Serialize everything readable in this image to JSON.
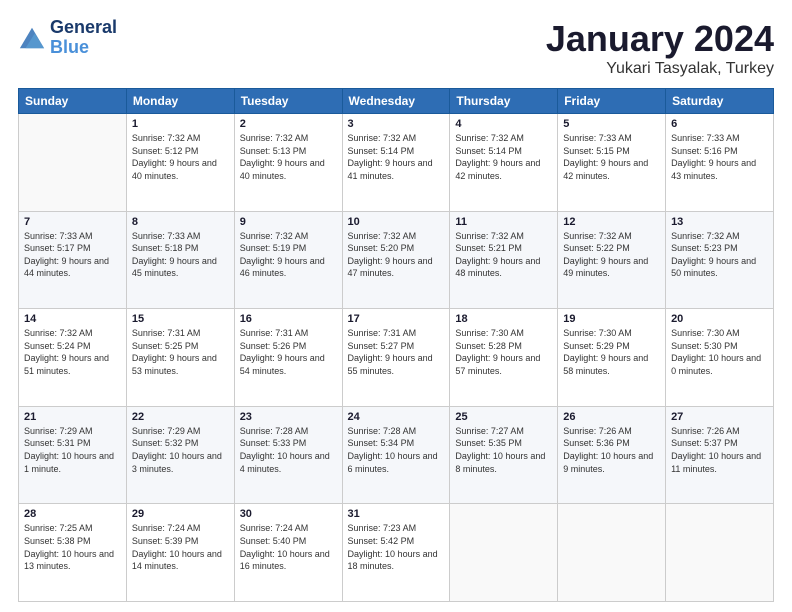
{
  "logo": {
    "line1": "General",
    "line2": "Blue"
  },
  "title": {
    "month": "January 2024",
    "location": "Yukari Tasyalak, Turkey"
  },
  "headers": [
    "Sunday",
    "Monday",
    "Tuesday",
    "Wednesday",
    "Thursday",
    "Friday",
    "Saturday"
  ],
  "weeks": [
    [
      {
        "day": "",
        "sunrise": "",
        "sunset": "",
        "daylight": ""
      },
      {
        "day": "1",
        "sunrise": "Sunrise: 7:32 AM",
        "sunset": "Sunset: 5:12 PM",
        "daylight": "Daylight: 9 hours and 40 minutes."
      },
      {
        "day": "2",
        "sunrise": "Sunrise: 7:32 AM",
        "sunset": "Sunset: 5:13 PM",
        "daylight": "Daylight: 9 hours and 40 minutes."
      },
      {
        "day": "3",
        "sunrise": "Sunrise: 7:32 AM",
        "sunset": "Sunset: 5:14 PM",
        "daylight": "Daylight: 9 hours and 41 minutes."
      },
      {
        "day": "4",
        "sunrise": "Sunrise: 7:32 AM",
        "sunset": "Sunset: 5:14 PM",
        "daylight": "Daylight: 9 hours and 42 minutes."
      },
      {
        "day": "5",
        "sunrise": "Sunrise: 7:33 AM",
        "sunset": "Sunset: 5:15 PM",
        "daylight": "Daylight: 9 hours and 42 minutes."
      },
      {
        "day": "6",
        "sunrise": "Sunrise: 7:33 AM",
        "sunset": "Sunset: 5:16 PM",
        "daylight": "Daylight: 9 hours and 43 minutes."
      }
    ],
    [
      {
        "day": "7",
        "sunrise": "Sunrise: 7:33 AM",
        "sunset": "Sunset: 5:17 PM",
        "daylight": "Daylight: 9 hours and 44 minutes."
      },
      {
        "day": "8",
        "sunrise": "Sunrise: 7:33 AM",
        "sunset": "Sunset: 5:18 PM",
        "daylight": "Daylight: 9 hours and 45 minutes."
      },
      {
        "day": "9",
        "sunrise": "Sunrise: 7:32 AM",
        "sunset": "Sunset: 5:19 PM",
        "daylight": "Daylight: 9 hours and 46 minutes."
      },
      {
        "day": "10",
        "sunrise": "Sunrise: 7:32 AM",
        "sunset": "Sunset: 5:20 PM",
        "daylight": "Daylight: 9 hours and 47 minutes."
      },
      {
        "day": "11",
        "sunrise": "Sunrise: 7:32 AM",
        "sunset": "Sunset: 5:21 PM",
        "daylight": "Daylight: 9 hours and 48 minutes."
      },
      {
        "day": "12",
        "sunrise": "Sunrise: 7:32 AM",
        "sunset": "Sunset: 5:22 PM",
        "daylight": "Daylight: 9 hours and 49 minutes."
      },
      {
        "day": "13",
        "sunrise": "Sunrise: 7:32 AM",
        "sunset": "Sunset: 5:23 PM",
        "daylight": "Daylight: 9 hours and 50 minutes."
      }
    ],
    [
      {
        "day": "14",
        "sunrise": "Sunrise: 7:32 AM",
        "sunset": "Sunset: 5:24 PM",
        "daylight": "Daylight: 9 hours and 51 minutes."
      },
      {
        "day": "15",
        "sunrise": "Sunrise: 7:31 AM",
        "sunset": "Sunset: 5:25 PM",
        "daylight": "Daylight: 9 hours and 53 minutes."
      },
      {
        "day": "16",
        "sunrise": "Sunrise: 7:31 AM",
        "sunset": "Sunset: 5:26 PM",
        "daylight": "Daylight: 9 hours and 54 minutes."
      },
      {
        "day": "17",
        "sunrise": "Sunrise: 7:31 AM",
        "sunset": "Sunset: 5:27 PM",
        "daylight": "Daylight: 9 hours and 55 minutes."
      },
      {
        "day": "18",
        "sunrise": "Sunrise: 7:30 AM",
        "sunset": "Sunset: 5:28 PM",
        "daylight": "Daylight: 9 hours and 57 minutes."
      },
      {
        "day": "19",
        "sunrise": "Sunrise: 7:30 AM",
        "sunset": "Sunset: 5:29 PM",
        "daylight": "Daylight: 9 hours and 58 minutes."
      },
      {
        "day": "20",
        "sunrise": "Sunrise: 7:30 AM",
        "sunset": "Sunset: 5:30 PM",
        "daylight": "Daylight: 10 hours and 0 minutes."
      }
    ],
    [
      {
        "day": "21",
        "sunrise": "Sunrise: 7:29 AM",
        "sunset": "Sunset: 5:31 PM",
        "daylight": "Daylight: 10 hours and 1 minute."
      },
      {
        "day": "22",
        "sunrise": "Sunrise: 7:29 AM",
        "sunset": "Sunset: 5:32 PM",
        "daylight": "Daylight: 10 hours and 3 minutes."
      },
      {
        "day": "23",
        "sunrise": "Sunrise: 7:28 AM",
        "sunset": "Sunset: 5:33 PM",
        "daylight": "Daylight: 10 hours and 4 minutes."
      },
      {
        "day": "24",
        "sunrise": "Sunrise: 7:28 AM",
        "sunset": "Sunset: 5:34 PM",
        "daylight": "Daylight: 10 hours and 6 minutes."
      },
      {
        "day": "25",
        "sunrise": "Sunrise: 7:27 AM",
        "sunset": "Sunset: 5:35 PM",
        "daylight": "Daylight: 10 hours and 8 minutes."
      },
      {
        "day": "26",
        "sunrise": "Sunrise: 7:26 AM",
        "sunset": "Sunset: 5:36 PM",
        "daylight": "Daylight: 10 hours and 9 minutes."
      },
      {
        "day": "27",
        "sunrise": "Sunrise: 7:26 AM",
        "sunset": "Sunset: 5:37 PM",
        "daylight": "Daylight: 10 hours and 11 minutes."
      }
    ],
    [
      {
        "day": "28",
        "sunrise": "Sunrise: 7:25 AM",
        "sunset": "Sunset: 5:38 PM",
        "daylight": "Daylight: 10 hours and 13 minutes."
      },
      {
        "day": "29",
        "sunrise": "Sunrise: 7:24 AM",
        "sunset": "Sunset: 5:39 PM",
        "daylight": "Daylight: 10 hours and 14 minutes."
      },
      {
        "day": "30",
        "sunrise": "Sunrise: 7:24 AM",
        "sunset": "Sunset: 5:40 PM",
        "daylight": "Daylight: 10 hours and 16 minutes."
      },
      {
        "day": "31",
        "sunrise": "Sunrise: 7:23 AM",
        "sunset": "Sunset: 5:42 PM",
        "daylight": "Daylight: 10 hours and 18 minutes."
      },
      {
        "day": "",
        "sunrise": "",
        "sunset": "",
        "daylight": ""
      },
      {
        "day": "",
        "sunrise": "",
        "sunset": "",
        "daylight": ""
      },
      {
        "day": "",
        "sunrise": "",
        "sunset": "",
        "daylight": ""
      }
    ]
  ]
}
